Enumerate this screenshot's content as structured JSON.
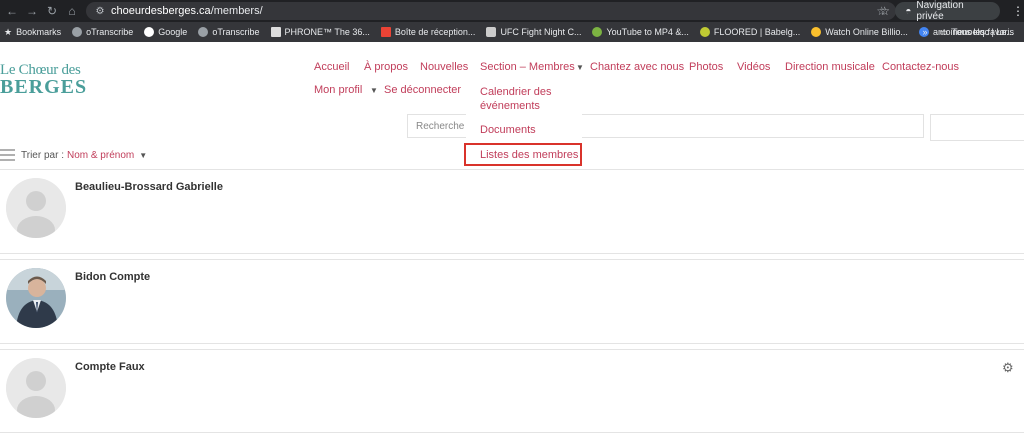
{
  "browser": {
    "url_domain": "choeurdesberges.ca",
    "url_path": "/members/",
    "private_label": "Navigation privée",
    "bookmarks": [
      {
        "label": "Bookmarks",
        "icon": "star-icon"
      },
      {
        "label": "oTranscribe",
        "icon": "globe-icon"
      },
      {
        "label": "Google",
        "icon": "google-icon"
      },
      {
        "label": "oTranscribe",
        "icon": "globe-icon"
      },
      {
        "label": "PHRONE™ The 36...",
        "icon": "page-icon"
      },
      {
        "label": "Boîte de réception...",
        "icon": "gmail-icon"
      },
      {
        "label": "UFC Fight Night C...",
        "icon": "tv-icon"
      },
      {
        "label": "YouTube to MP4 &...",
        "icon": "download-icon"
      },
      {
        "label": "FLOORED | Babelg...",
        "icon": "ball-icon"
      },
      {
        "label": "Watch Online Billio...",
        "icon": "circle-icon"
      },
      {
        "label": "antoinenoelqc | Le...",
        "icon": "wordpress-icon"
      }
    ],
    "all_bookmarks": "Tous les favoris"
  },
  "site": {
    "logo_top": "Le Chœur des",
    "logo_bottom": "BERGES",
    "menu": {
      "accueil": "Accueil",
      "apropos": "À propos",
      "nouvelles": "Nouvelles",
      "section": "Section – Membres",
      "chantez": "Chantez avec nous",
      "photos": "Photos",
      "videos": "Vidéos",
      "direction": "Direction musicale",
      "contact": "Contactez-nous",
      "profil": "Mon profil",
      "deconnecter": "Se déconnecter"
    },
    "dropdown": {
      "calendrier_line1": "Calendrier des",
      "calendrier_line2": "événements",
      "documents": "Documents",
      "listes": "Listes des membres"
    },
    "search_placeholder": "Recherche",
    "sort_label": "Trier par :",
    "sort_value": "Nom & prénom"
  },
  "members": [
    {
      "name": "Beaulieu-Brossard Gabrielle",
      "avatar": "default"
    },
    {
      "name": "Bidon Compte",
      "avatar": "photo"
    },
    {
      "name": "Compte Faux",
      "avatar": "default"
    }
  ]
}
